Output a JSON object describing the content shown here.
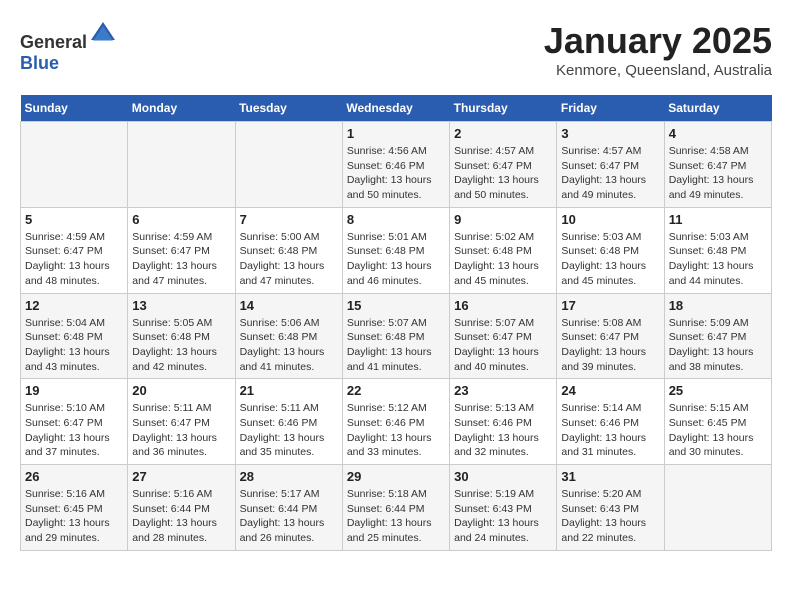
{
  "header": {
    "logo_general": "General",
    "logo_blue": "Blue",
    "month": "January 2025",
    "location": "Kenmore, Queensland, Australia"
  },
  "weekdays": [
    "Sunday",
    "Monday",
    "Tuesday",
    "Wednesday",
    "Thursday",
    "Friday",
    "Saturday"
  ],
  "weeks": [
    [
      {
        "day": null
      },
      {
        "day": null
      },
      {
        "day": null
      },
      {
        "day": "1",
        "sunrise": "4:56 AM",
        "sunset": "6:46 PM",
        "daylight": "13 hours and 50 minutes."
      },
      {
        "day": "2",
        "sunrise": "4:57 AM",
        "sunset": "6:47 PM",
        "daylight": "13 hours and 50 minutes."
      },
      {
        "day": "3",
        "sunrise": "4:57 AM",
        "sunset": "6:47 PM",
        "daylight": "13 hours and 49 minutes."
      },
      {
        "day": "4",
        "sunrise": "4:58 AM",
        "sunset": "6:47 PM",
        "daylight": "13 hours and 49 minutes."
      }
    ],
    [
      {
        "day": "5",
        "sunrise": "4:59 AM",
        "sunset": "6:47 PM",
        "daylight": "13 hours and 48 minutes."
      },
      {
        "day": "6",
        "sunrise": "4:59 AM",
        "sunset": "6:47 PM",
        "daylight": "13 hours and 47 minutes."
      },
      {
        "day": "7",
        "sunrise": "5:00 AM",
        "sunset": "6:48 PM",
        "daylight": "13 hours and 47 minutes."
      },
      {
        "day": "8",
        "sunrise": "5:01 AM",
        "sunset": "6:48 PM",
        "daylight": "13 hours and 46 minutes."
      },
      {
        "day": "9",
        "sunrise": "5:02 AM",
        "sunset": "6:48 PM",
        "daylight": "13 hours and 45 minutes."
      },
      {
        "day": "10",
        "sunrise": "5:03 AM",
        "sunset": "6:48 PM",
        "daylight": "13 hours and 45 minutes."
      },
      {
        "day": "11",
        "sunrise": "5:03 AM",
        "sunset": "6:48 PM",
        "daylight": "13 hours and 44 minutes."
      }
    ],
    [
      {
        "day": "12",
        "sunrise": "5:04 AM",
        "sunset": "6:48 PM",
        "daylight": "13 hours and 43 minutes."
      },
      {
        "day": "13",
        "sunrise": "5:05 AM",
        "sunset": "6:48 PM",
        "daylight": "13 hours and 42 minutes."
      },
      {
        "day": "14",
        "sunrise": "5:06 AM",
        "sunset": "6:48 PM",
        "daylight": "13 hours and 41 minutes."
      },
      {
        "day": "15",
        "sunrise": "5:07 AM",
        "sunset": "6:48 PM",
        "daylight": "13 hours and 41 minutes."
      },
      {
        "day": "16",
        "sunrise": "5:07 AM",
        "sunset": "6:47 PM",
        "daylight": "13 hours and 40 minutes."
      },
      {
        "day": "17",
        "sunrise": "5:08 AM",
        "sunset": "6:47 PM",
        "daylight": "13 hours and 39 minutes."
      },
      {
        "day": "18",
        "sunrise": "5:09 AM",
        "sunset": "6:47 PM",
        "daylight": "13 hours and 38 minutes."
      }
    ],
    [
      {
        "day": "19",
        "sunrise": "5:10 AM",
        "sunset": "6:47 PM",
        "daylight": "13 hours and 37 minutes."
      },
      {
        "day": "20",
        "sunrise": "5:11 AM",
        "sunset": "6:47 PM",
        "daylight": "13 hours and 36 minutes."
      },
      {
        "day": "21",
        "sunrise": "5:11 AM",
        "sunset": "6:46 PM",
        "daylight": "13 hours and 35 minutes."
      },
      {
        "day": "22",
        "sunrise": "5:12 AM",
        "sunset": "6:46 PM",
        "daylight": "13 hours and 33 minutes."
      },
      {
        "day": "23",
        "sunrise": "5:13 AM",
        "sunset": "6:46 PM",
        "daylight": "13 hours and 32 minutes."
      },
      {
        "day": "24",
        "sunrise": "5:14 AM",
        "sunset": "6:46 PM",
        "daylight": "13 hours and 31 minutes."
      },
      {
        "day": "25",
        "sunrise": "5:15 AM",
        "sunset": "6:45 PM",
        "daylight": "13 hours and 30 minutes."
      }
    ],
    [
      {
        "day": "26",
        "sunrise": "5:16 AM",
        "sunset": "6:45 PM",
        "daylight": "13 hours and 29 minutes."
      },
      {
        "day": "27",
        "sunrise": "5:16 AM",
        "sunset": "6:44 PM",
        "daylight": "13 hours and 28 minutes."
      },
      {
        "day": "28",
        "sunrise": "5:17 AM",
        "sunset": "6:44 PM",
        "daylight": "13 hours and 26 minutes."
      },
      {
        "day": "29",
        "sunrise": "5:18 AM",
        "sunset": "6:44 PM",
        "daylight": "13 hours and 25 minutes."
      },
      {
        "day": "30",
        "sunrise": "5:19 AM",
        "sunset": "6:43 PM",
        "daylight": "13 hours and 24 minutes."
      },
      {
        "day": "31",
        "sunrise": "5:20 AM",
        "sunset": "6:43 PM",
        "daylight": "13 hours and 22 minutes."
      },
      {
        "day": null
      }
    ]
  ],
  "labels": {
    "sunrise_prefix": "Sunrise: ",
    "sunset_prefix": "Sunset: ",
    "daylight_prefix": "Daylight: "
  }
}
